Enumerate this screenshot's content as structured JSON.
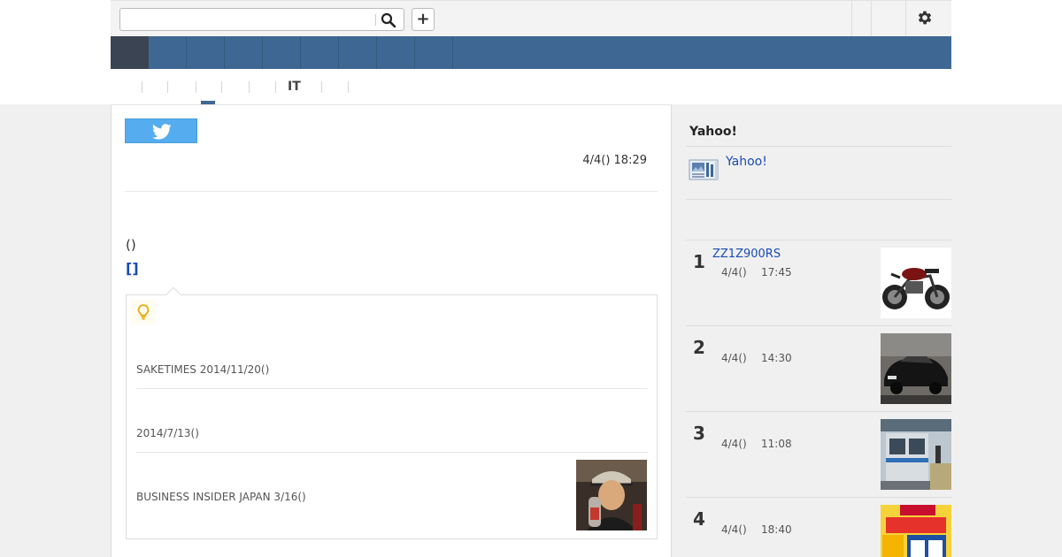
{
  "search": {
    "value": "",
    "placeholder": ""
  },
  "topbar": {
    "add_label": "+"
  },
  "subnav": {
    "tab_it": "IT"
  },
  "article": {
    "date": "4/4() 18:29",
    "paren_text": "()",
    "bracket_link": "[]"
  },
  "related": {
    "items": [
      {
        "text": "SAKETIMES 2014/11/20()"
      },
      {
        "text": " 2014/7/13()"
      },
      {
        "text": "BUSINESS INSIDER JAPAN 3/16()"
      }
    ]
  },
  "sidebar": {
    "title": "Yahoo!",
    "yahoo_link": "Yahoo!",
    "ranking": [
      {
        "num": "1",
        "title": "ZZ1Z900RS",
        "date": "4/4()",
        "time": "17:45"
      },
      {
        "num": "2",
        "title": "",
        "date": "4/4()",
        "time": "14:30"
      },
      {
        "num": "3",
        "title": "",
        "date": "4/4()",
        "time": "11:08"
      },
      {
        "num": "4",
        "title": "",
        "date": "4/4()",
        "time": "18:40"
      }
    ]
  },
  "colors": {
    "nav_blue": "#3e6893",
    "nav_home": "#3b4452",
    "link_blue": "#1a4bb3",
    "twitter": "#55acee"
  },
  "icons": [
    "search-icon",
    "plus-icon",
    "gear-icon",
    "twitter-icon",
    "lightbulb-icon",
    "yahoo-news-icon"
  ]
}
